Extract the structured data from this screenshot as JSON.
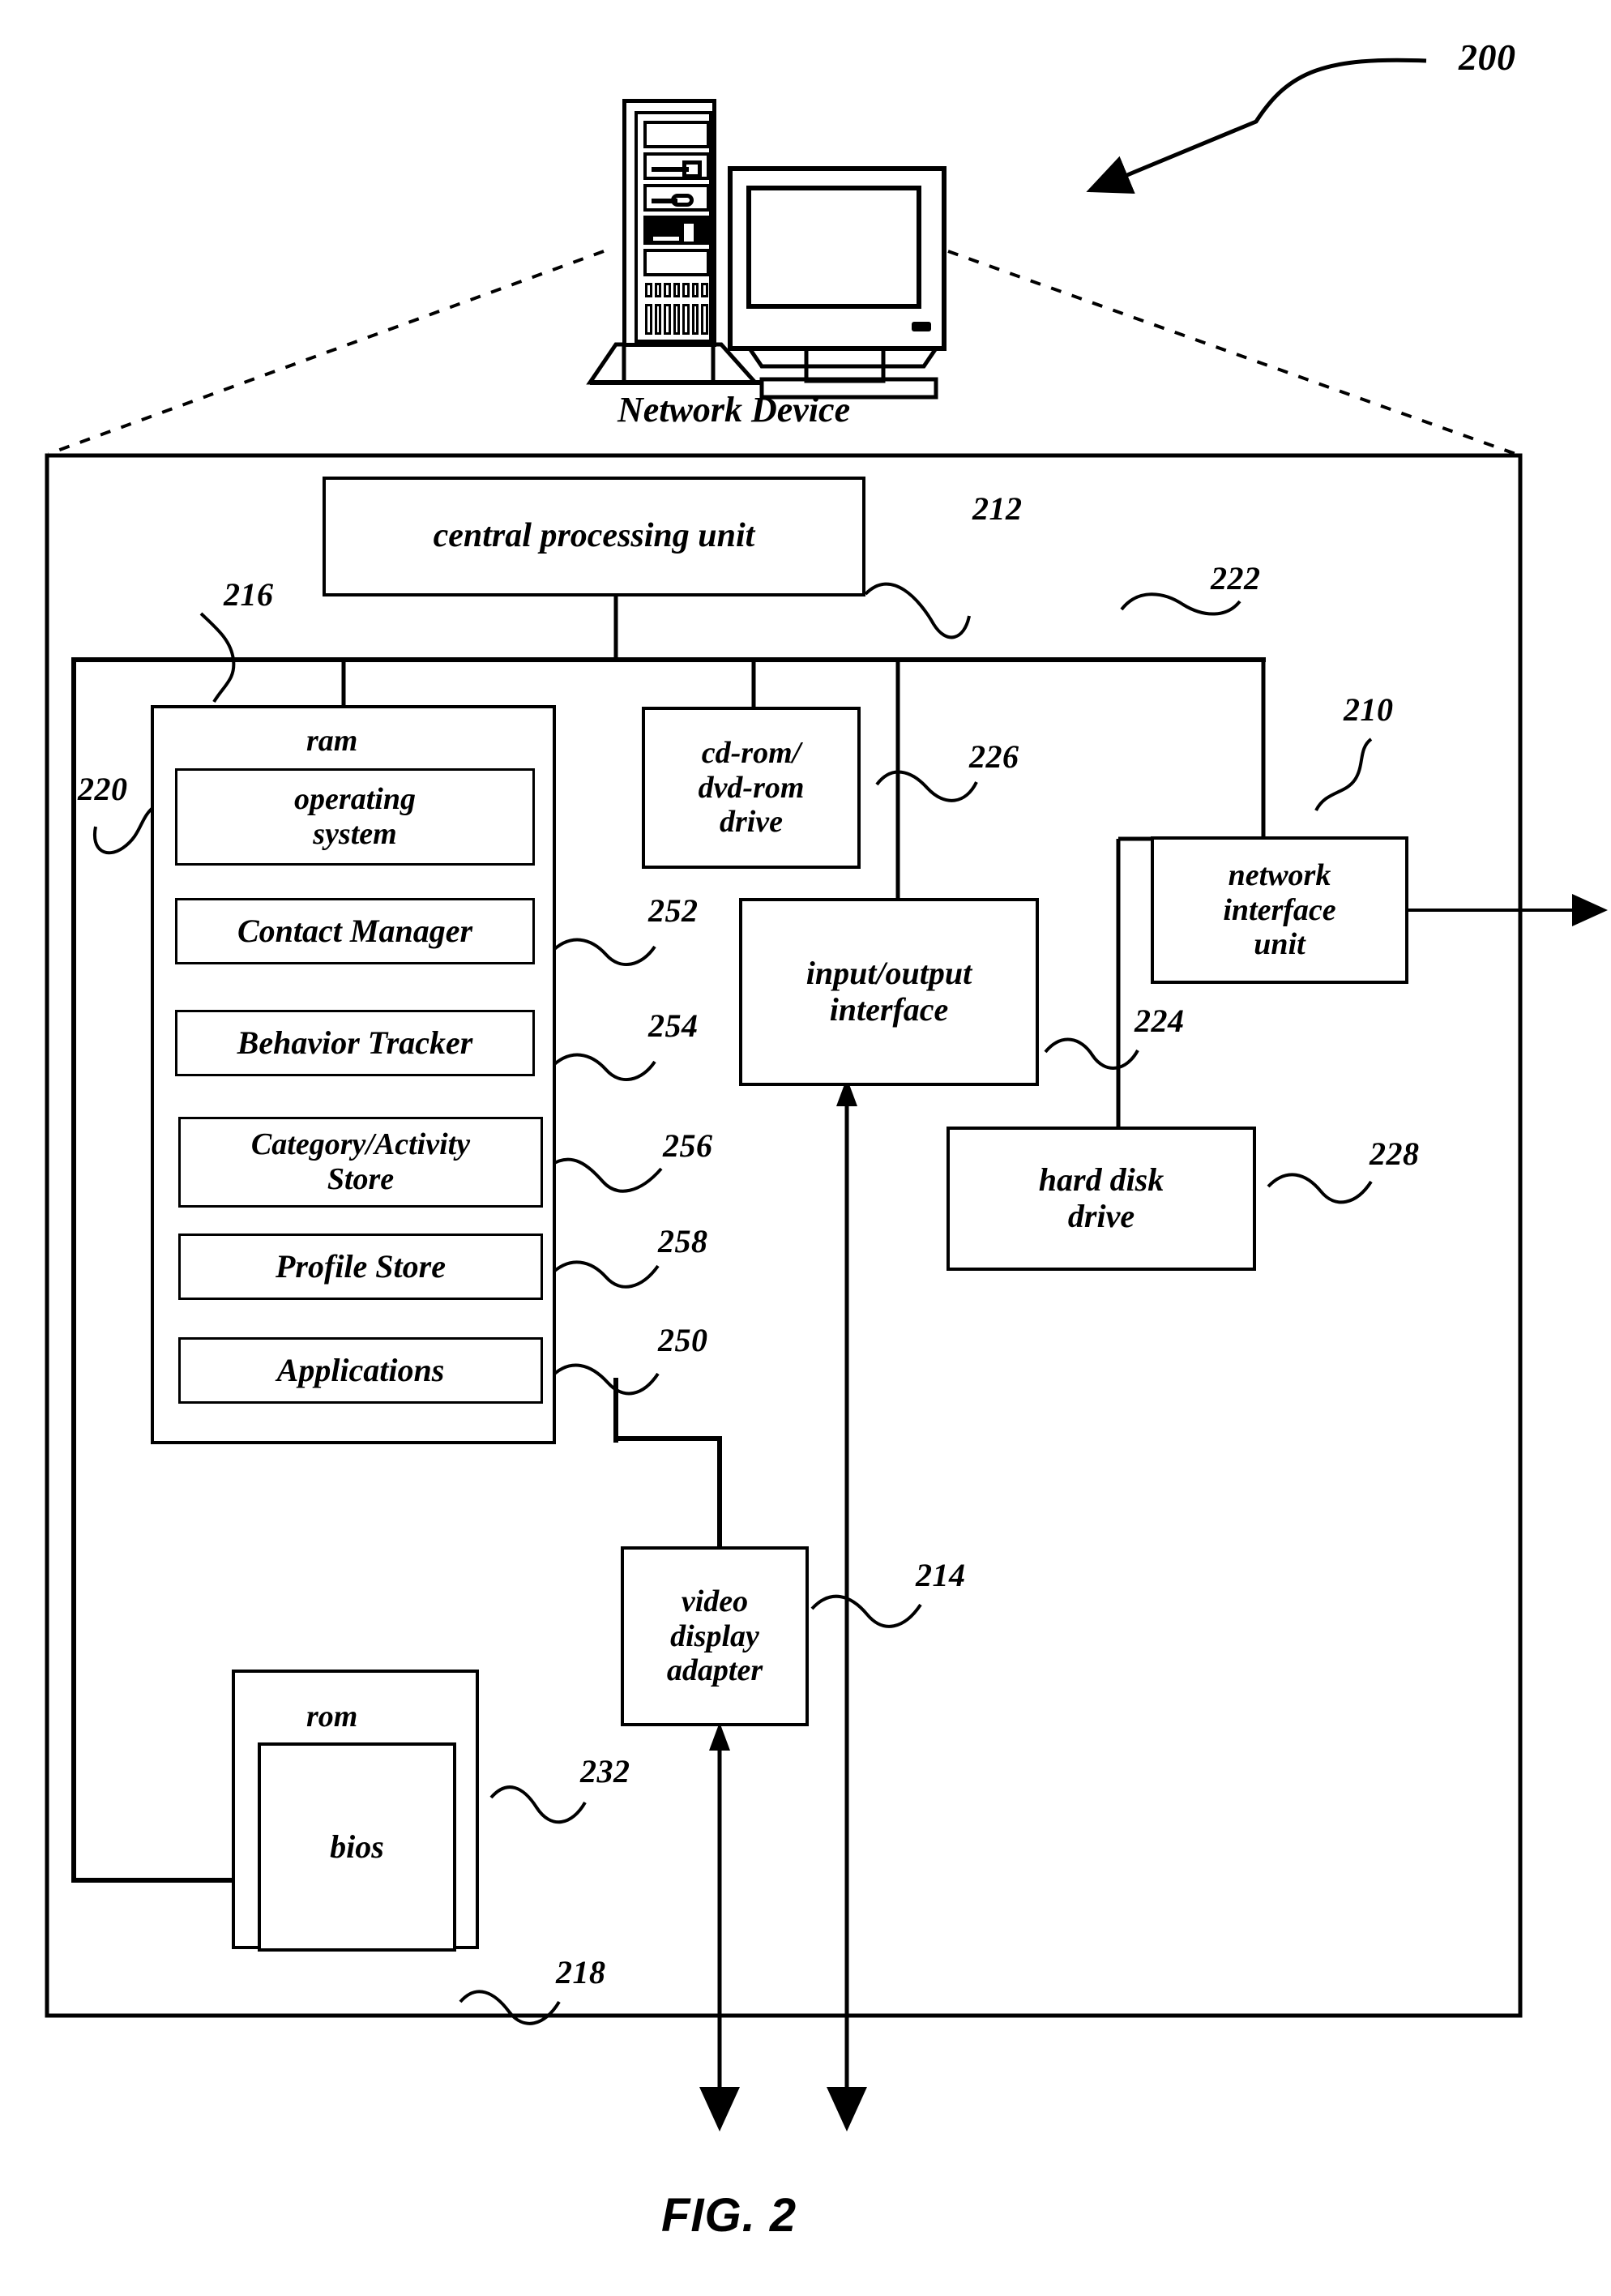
{
  "figure": {
    "caption": "FIG. 2",
    "overall_ref": "200",
    "device_label": "Network Device"
  },
  "blocks": {
    "cpu": {
      "label": "central processing unit",
      "ref": "212"
    },
    "ram": {
      "label": "ram",
      "ref": "216"
    },
    "operating_system": {
      "label": "operating\nsystem",
      "ref": "220"
    },
    "contact_manager": {
      "label": "Contact Manager",
      "ref": "252"
    },
    "behavior_tracker": {
      "label": "Behavior Tracker",
      "ref": "254"
    },
    "category_activity_store": {
      "label": "Category/Activity\nStore",
      "ref": "256"
    },
    "profile_store": {
      "label": "Profile Store",
      "ref": "258"
    },
    "applications": {
      "label": "Applications",
      "ref": "250"
    },
    "cdrom": {
      "label": "cd-rom/\ndvd-rom\ndrive",
      "ref": "226"
    },
    "io_interface": {
      "label": "input/output\ninterface",
      "ref": "224"
    },
    "network_interface_unit": {
      "label": "network\ninterface\nunit",
      "ref": "210"
    },
    "hard_disk_drive": {
      "label": "hard disk\ndrive",
      "ref": "228"
    },
    "video_display_adapter": {
      "label": "video\ndisplay\nadapter",
      "ref": "214"
    },
    "rom": {
      "label": "rom",
      "ref": "232"
    },
    "bios": {
      "label": "bios",
      "ref": "218"
    },
    "bus": {
      "ref": "222"
    }
  },
  "ref_labels": {
    "r200": "200",
    "r210": "210",
    "r212": "212",
    "r214": "214",
    "r216": "216",
    "r218": "218",
    "r220": "220",
    "r222": "222",
    "r224": "224",
    "r226": "226",
    "r228": "228",
    "r232": "232",
    "r250": "250",
    "r252": "252",
    "r254": "254",
    "r256": "256",
    "r258": "258"
  },
  "block_text": {
    "cpu": "central processing unit",
    "ram": "ram",
    "os_line1": "operating",
    "os_line2": "system",
    "contact_manager": "Contact Manager",
    "behavior_tracker": "Behavior Tracker",
    "cat_line1": "Category/Activity",
    "cat_line2": "Store",
    "profile_store": "Profile Store",
    "applications": "Applications",
    "cdrom_line1": "cd-rom/",
    "cdrom_line2": "dvd-rom",
    "cdrom_line3": "drive",
    "io_line1": "input/output",
    "io_line2": "interface",
    "niu_line1": "network",
    "niu_line2": "interface",
    "niu_line3": "unit",
    "hdd_line1": "hard disk",
    "hdd_line2": "drive",
    "vda_line1": "video",
    "vda_line2": "display",
    "vda_line3": "adapter",
    "rom": "rom",
    "bios": "bios"
  },
  "colors": {
    "stroke": "#000000",
    "background": "#ffffff"
  }
}
